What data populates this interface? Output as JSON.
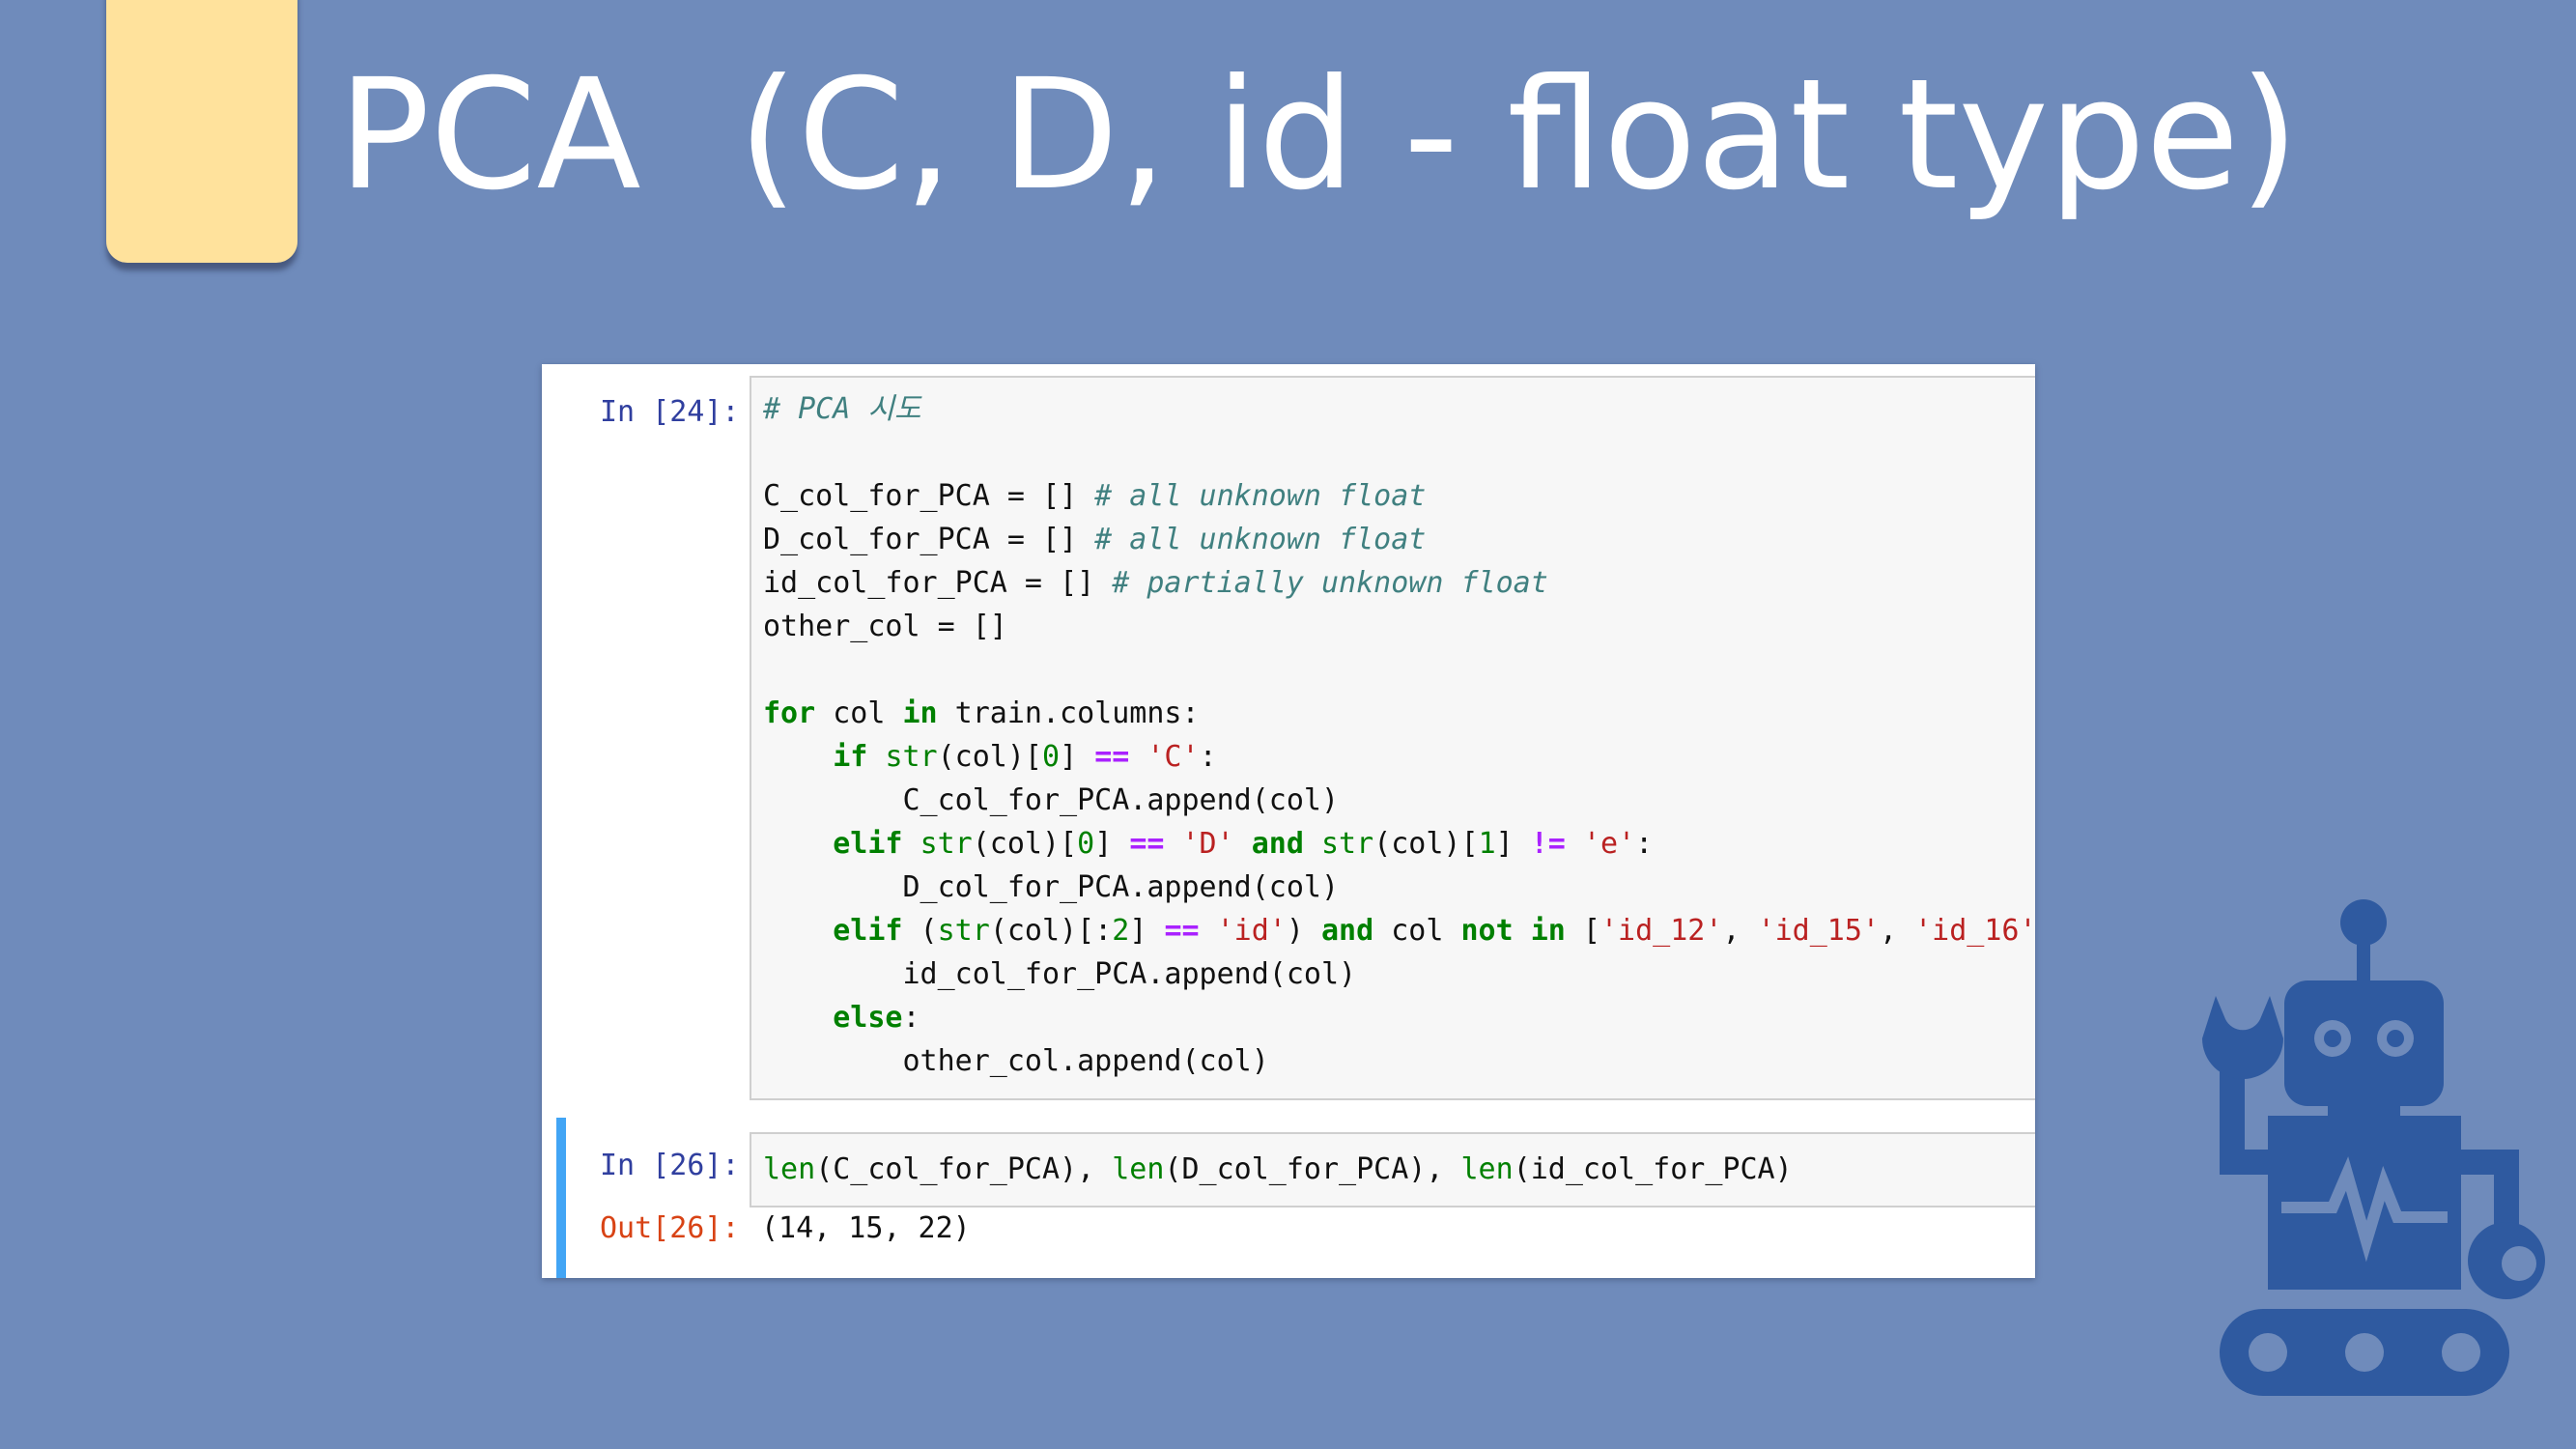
{
  "slide": {
    "title": "PCA  (C, D, id - float type)"
  },
  "notebook": {
    "cell1": {
      "prompt": "In [24]:",
      "lines": [
        [
          {
            "t": "c",
            "v": "# PCA 시도"
          }
        ],
        [
          {
            "t": "p",
            "v": ""
          }
        ],
        [
          {
            "t": "p",
            "v": "C_col_for_PCA = [] "
          },
          {
            "t": "c",
            "v": "# all unknown float"
          }
        ],
        [
          {
            "t": "p",
            "v": "D_col_for_PCA = [] "
          },
          {
            "t": "c",
            "v": "# all unknown float"
          }
        ],
        [
          {
            "t": "p",
            "v": "id_col_for_PCA = [] "
          },
          {
            "t": "c",
            "v": "# partially unknown float"
          }
        ],
        [
          {
            "t": "p",
            "v": "other_col = []"
          }
        ],
        [
          {
            "t": "p",
            "v": ""
          }
        ],
        [
          {
            "t": "k",
            "v": "for"
          },
          {
            "t": "p",
            "v": " col "
          },
          {
            "t": "k",
            "v": "in"
          },
          {
            "t": "p",
            "v": " train.columns:"
          }
        ],
        [
          {
            "t": "p",
            "v": "    "
          },
          {
            "t": "k",
            "v": "if"
          },
          {
            "t": "p",
            "v": " "
          },
          {
            "t": "b",
            "v": "str"
          },
          {
            "t": "p",
            "v": "(col)["
          },
          {
            "t": "n",
            "v": "0"
          },
          {
            "t": "p",
            "v": "] "
          },
          {
            "t": "o",
            "v": "=="
          },
          {
            "t": "p",
            "v": " "
          },
          {
            "t": "s",
            "v": "'C'"
          },
          {
            "t": "p",
            "v": ":"
          }
        ],
        [
          {
            "t": "p",
            "v": "        C_col_for_PCA.append(col)"
          }
        ],
        [
          {
            "t": "p",
            "v": "    "
          },
          {
            "t": "k",
            "v": "elif"
          },
          {
            "t": "p",
            "v": " "
          },
          {
            "t": "b",
            "v": "str"
          },
          {
            "t": "p",
            "v": "(col)["
          },
          {
            "t": "n",
            "v": "0"
          },
          {
            "t": "p",
            "v": "] "
          },
          {
            "t": "o",
            "v": "=="
          },
          {
            "t": "p",
            "v": " "
          },
          {
            "t": "s",
            "v": "'D'"
          },
          {
            "t": "p",
            "v": " "
          },
          {
            "t": "k",
            "v": "and"
          },
          {
            "t": "p",
            "v": " "
          },
          {
            "t": "b",
            "v": "str"
          },
          {
            "t": "p",
            "v": "(col)["
          },
          {
            "t": "n",
            "v": "1"
          },
          {
            "t": "p",
            "v": "] "
          },
          {
            "t": "o",
            "v": "!="
          },
          {
            "t": "p",
            "v": " "
          },
          {
            "t": "s",
            "v": "'e'"
          },
          {
            "t": "p",
            "v": ":"
          }
        ],
        [
          {
            "t": "p",
            "v": "        D_col_for_PCA.append(col)"
          }
        ],
        [
          {
            "t": "p",
            "v": "    "
          },
          {
            "t": "k",
            "v": "elif"
          },
          {
            "t": "p",
            "v": " ("
          },
          {
            "t": "b",
            "v": "str"
          },
          {
            "t": "p",
            "v": "(col)[:"
          },
          {
            "t": "n",
            "v": "2"
          },
          {
            "t": "p",
            "v": "] "
          },
          {
            "t": "o",
            "v": "=="
          },
          {
            "t": "p",
            "v": " "
          },
          {
            "t": "s",
            "v": "'id'"
          },
          {
            "t": "p",
            "v": ") "
          },
          {
            "t": "k",
            "v": "and"
          },
          {
            "t": "p",
            "v": " col "
          },
          {
            "t": "k",
            "v": "not"
          },
          {
            "t": "p",
            "v": " "
          },
          {
            "t": "k",
            "v": "in"
          },
          {
            "t": "p",
            "v": " ["
          },
          {
            "t": "s",
            "v": "'id_12'"
          },
          {
            "t": "p",
            "v": ", "
          },
          {
            "t": "s",
            "v": "'id_15'"
          },
          {
            "t": "p",
            "v": ", "
          },
          {
            "t": "s",
            "v": "'id_16'"
          },
          {
            "t": "p",
            "v": ","
          }
        ],
        [
          {
            "t": "p",
            "v": "        id_col_for_PCA.append(col)"
          }
        ],
        [
          {
            "t": "p",
            "v": "    "
          },
          {
            "t": "k",
            "v": "else"
          },
          {
            "t": "p",
            "v": ":"
          }
        ],
        [
          {
            "t": "p",
            "v": "        other_col.append(col)"
          }
        ]
      ]
    },
    "cell2": {
      "prompt": "In [26]:",
      "line": [
        {
          "t": "b",
          "v": "len"
        },
        {
          "t": "p",
          "v": "(C_col_for_PCA), "
        },
        {
          "t": "b",
          "v": "len"
        },
        {
          "t": "p",
          "v": "(D_col_for_PCA), "
        },
        {
          "t": "b",
          "v": "len"
        },
        {
          "t": "p",
          "v": "(id_col_for_PCA)"
        }
      ],
      "out_prompt": "Out[26]:",
      "output": "(14, 15, 22)"
    }
  },
  "colors": {
    "background": "#6f8bbb",
    "tab": "#ffe29c",
    "robot": "#2f5aa0",
    "keyword": "#008000",
    "string": "#ba2121",
    "comment": "#408080",
    "operator": "#aa22ff",
    "cell_border_active": "#42a5f5"
  },
  "icons": {
    "robot": "robot-icon"
  }
}
